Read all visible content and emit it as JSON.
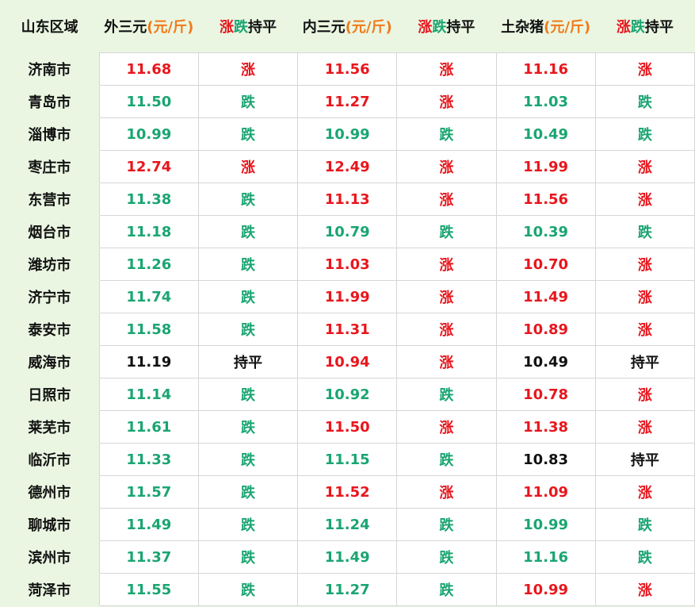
{
  "headers": {
    "region": "山东区域",
    "outer": {
      "name": "外三元",
      "unit": "(元/斤)"
    },
    "outer_trend": {
      "up": "涨",
      "down": "跌",
      "flat": "持平"
    },
    "inner": {
      "name": "内三元",
      "unit": "(元/斤)"
    },
    "inner_trend": {
      "up": "涨",
      "down": "跌",
      "flat": "持平"
    },
    "local": {
      "name": "土杂猪",
      "unit": "(元/斤)"
    },
    "local_trend": {
      "up": "涨",
      "down": "跌",
      "flat": "持平"
    }
  },
  "colors": {
    "up": "#e8161d",
    "down": "#1aa572",
    "flat": "#111111",
    "unit": "#f07a1a"
  },
  "rows": [
    {
      "city": "济南市",
      "outer": "11.68",
      "outer_trend": "涨",
      "inner": "11.56",
      "inner_trend": "涨",
      "local": "11.16",
      "local_trend": "涨"
    },
    {
      "city": "青岛市",
      "outer": "11.50",
      "outer_trend": "跌",
      "inner": "11.27",
      "inner_trend": "涨",
      "local": "11.03",
      "local_trend": "跌"
    },
    {
      "city": "淄博市",
      "outer": "10.99",
      "outer_trend": "跌",
      "inner": "10.99",
      "inner_trend": "跌",
      "local": "10.49",
      "local_trend": "跌"
    },
    {
      "city": "枣庄市",
      "outer": "12.74",
      "outer_trend": "涨",
      "inner": "12.49",
      "inner_trend": "涨",
      "local": "11.99",
      "local_trend": "涨"
    },
    {
      "city": "东营市",
      "outer": "11.38",
      "outer_trend": "跌",
      "inner": "11.13",
      "inner_trend": "涨",
      "local": "11.56",
      "local_trend": "涨"
    },
    {
      "city": "烟台市",
      "outer": "11.18",
      "outer_trend": "跌",
      "inner": "10.79",
      "inner_trend": "跌",
      "local": "10.39",
      "local_trend": "跌"
    },
    {
      "city": "潍坊市",
      "outer": "11.26",
      "outer_trend": "跌",
      "inner": "11.03",
      "inner_trend": "涨",
      "local": "10.70",
      "local_trend": "涨"
    },
    {
      "city": "济宁市",
      "outer": "11.74",
      "outer_trend": "跌",
      "inner": "11.99",
      "inner_trend": "涨",
      "local": "11.49",
      "local_trend": "涨"
    },
    {
      "city": "泰安市",
      "outer": "11.58",
      "outer_trend": "跌",
      "inner": "11.31",
      "inner_trend": "涨",
      "local": "10.89",
      "local_trend": "涨"
    },
    {
      "city": "威海市",
      "outer": "11.19",
      "outer_trend": "持平",
      "inner": "10.94",
      "inner_trend": "涨",
      "local": "10.49",
      "local_trend": "持平"
    },
    {
      "city": "日照市",
      "outer": "11.14",
      "outer_trend": "跌",
      "inner": "10.92",
      "inner_trend": "跌",
      "local": "10.78",
      "local_trend": "涨"
    },
    {
      "city": "莱芜市",
      "outer": "11.61",
      "outer_trend": "跌",
      "inner": "11.50",
      "inner_trend": "涨",
      "local": "11.38",
      "local_trend": "涨"
    },
    {
      "city": "临沂市",
      "outer": "11.33",
      "outer_trend": "跌",
      "inner": "11.15",
      "inner_trend": "跌",
      "local": "10.83",
      "local_trend": "持平"
    },
    {
      "city": "德州市",
      "outer": "11.57",
      "outer_trend": "跌",
      "inner": "11.52",
      "inner_trend": "涨",
      "local": "11.09",
      "local_trend": "涨"
    },
    {
      "city": "聊城市",
      "outer": "11.49",
      "outer_trend": "跌",
      "inner": "11.24",
      "inner_trend": "跌",
      "local": "10.99",
      "local_trend": "跌"
    },
    {
      "city": "滨州市",
      "outer": "11.37",
      "outer_trend": "跌",
      "inner": "11.49",
      "inner_trend": "跌",
      "local": "11.16",
      "local_trend": "跌"
    },
    {
      "city": "菏泽市",
      "outer": "11.55",
      "outer_trend": "跌",
      "inner": "11.27",
      "inner_trend": "跌",
      "local": "10.99",
      "local_trend": "涨"
    }
  ]
}
